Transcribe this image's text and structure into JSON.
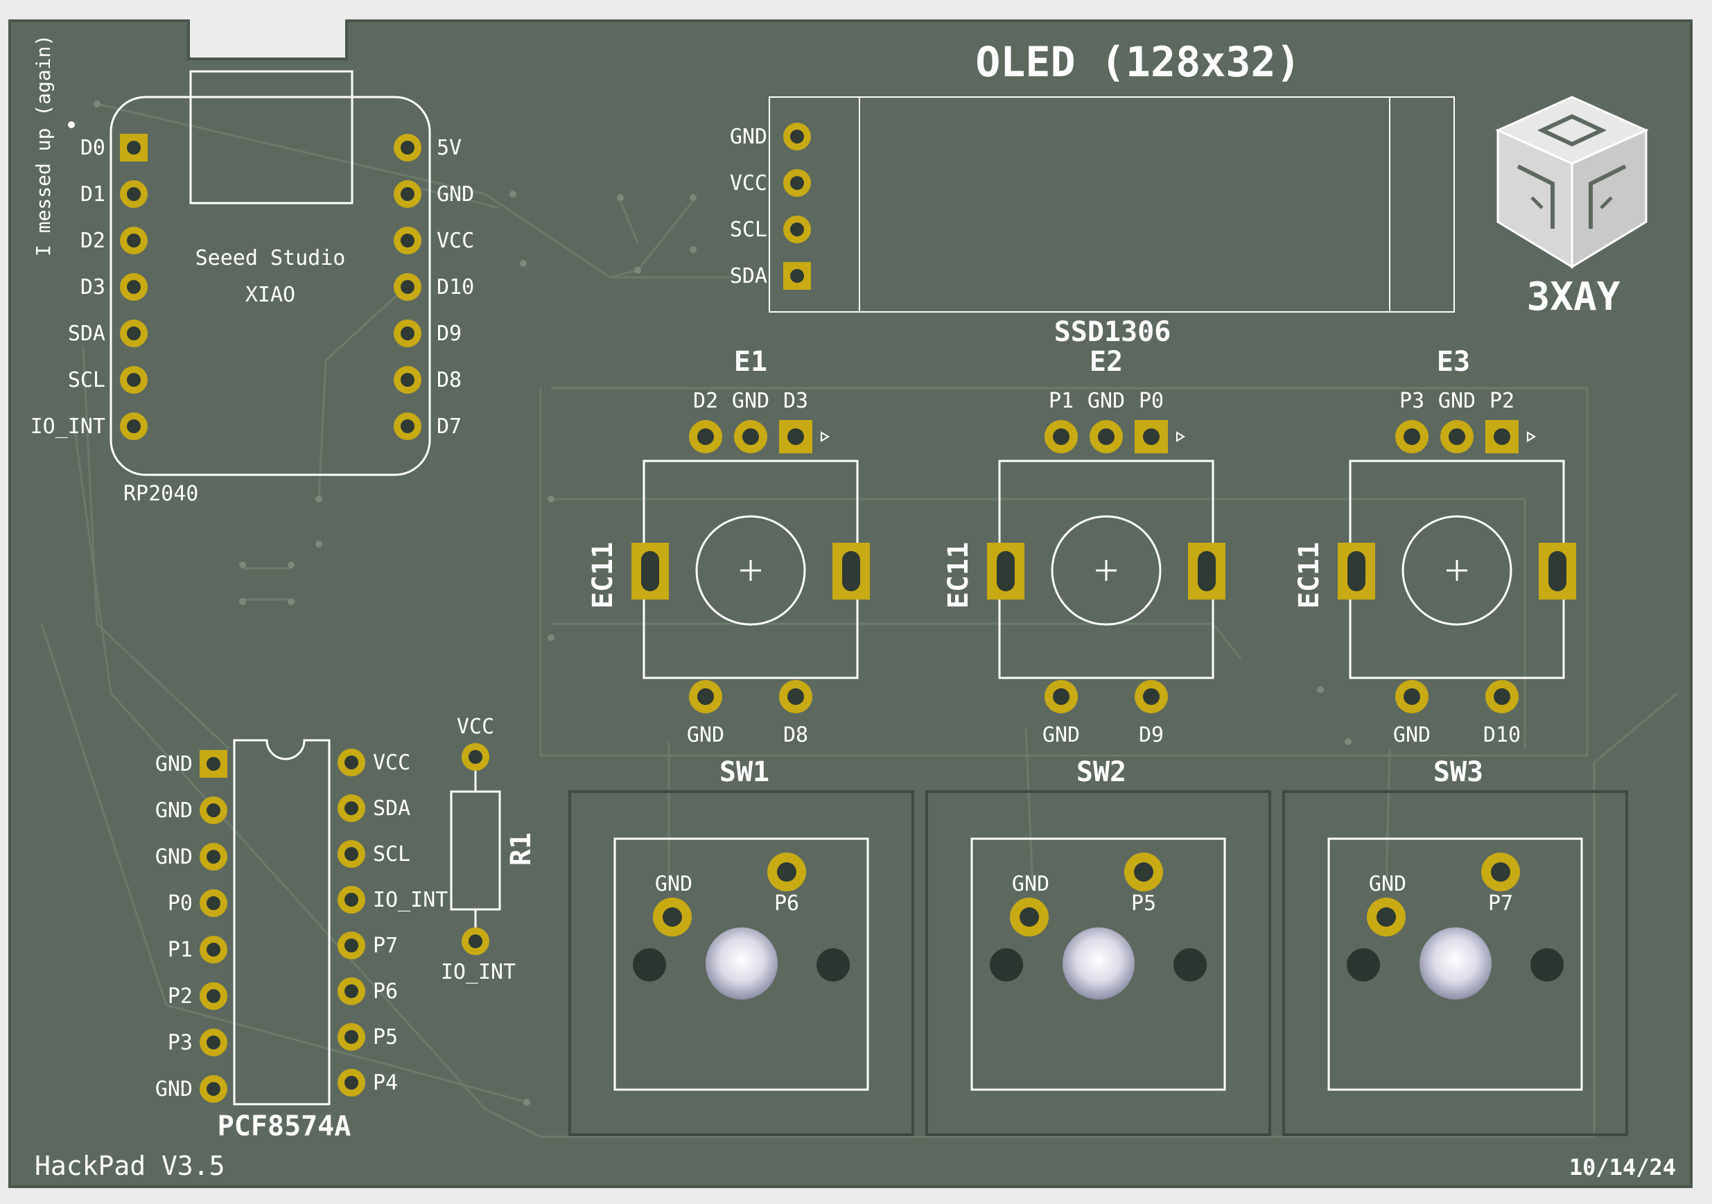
{
  "board": {
    "name": "HackPad V3.5",
    "date": "10/14/24",
    "note": "I messed up (again)",
    "logo_text": "3XAY",
    "colors": {
      "soldermask": "#5d695f",
      "copper": "#c8aa14",
      "silkscreen": "#ffffff",
      "background": "#ececec"
    }
  },
  "mcu": {
    "title_line1": "Seeed Studio",
    "title_line2": "XIAO",
    "ref": "RP2040",
    "left_pins": [
      "D0",
      "D1",
      "D2",
      "D3",
      "SDA",
      "SCL",
      "IO_INT"
    ],
    "right_pins": [
      "5V",
      "GND",
      "VCC",
      "D10",
      "D9",
      "D8",
      "D7"
    ]
  },
  "oled": {
    "title": "OLED (128x32)",
    "ref": "SSD1306",
    "pins": [
      "GND",
      "VCC",
      "SCL",
      "SDA"
    ]
  },
  "encoders": [
    {
      "ref": "E1",
      "part": "EC11",
      "top_pins": [
        "D2",
        "GND",
        "D3"
      ],
      "bottom_pins": [
        "GND",
        "D8"
      ]
    },
    {
      "ref": "E2",
      "part": "EC11",
      "top_pins": [
        "P1",
        "GND",
        "P0"
      ],
      "bottom_pins": [
        "GND",
        "D9"
      ]
    },
    {
      "ref": "E3",
      "part": "EC11",
      "top_pins": [
        "P3",
        "GND",
        "P2"
      ],
      "bottom_pins": [
        "GND",
        "D10"
      ]
    }
  ],
  "switches": [
    {
      "ref": "SW1",
      "pins": [
        "GND",
        "P6"
      ]
    },
    {
      "ref": "SW2",
      "pins": [
        "GND",
        "P5"
      ]
    },
    {
      "ref": "SW3",
      "pins": [
        "GND",
        "P7"
      ]
    }
  ],
  "expander": {
    "ref": "PCF8574A",
    "left_pins": [
      "GND",
      "GND",
      "GND",
      "P0",
      "P1",
      "P2",
      "P3",
      "GND"
    ],
    "right_pins": [
      "VCC",
      "SDA",
      "SCL",
      "IO_INT",
      "P7",
      "P6",
      "P5",
      "P4"
    ]
  },
  "resistor": {
    "ref": "R1",
    "top_pin": "VCC",
    "bottom_pin": "IO_INT"
  }
}
